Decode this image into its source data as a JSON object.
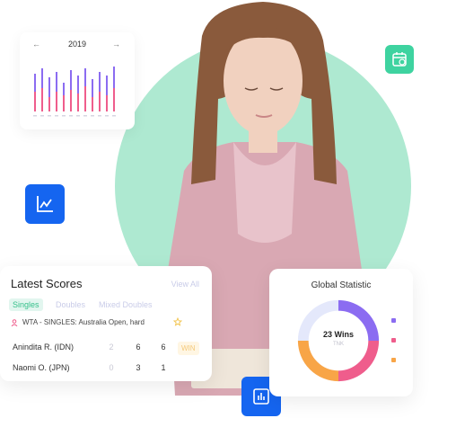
{
  "year_card": {
    "prev_icon": "arrow-left-icon",
    "next_icon": "arrow-right-icon",
    "year": "2019",
    "prev_label": "←",
    "next_label": "→"
  },
  "icons": {
    "calendar_badge": "calendar-icon",
    "line_chart_badge": "line-chart-icon",
    "bar_chart_badge": "bar-chart-icon"
  },
  "latest_scores": {
    "title": "Latest Scores",
    "view_all": "View All",
    "tabs": [
      "Singles",
      "Doubles",
      "Mixed Doubles"
    ],
    "event": "WTA - SINGLES: Australia Open, hard",
    "players": [
      {
        "name": "Anindita R. (IDN)",
        "scores": [
          "2",
          "6",
          "6"
        ]
      },
      {
        "name": "Naomi O. (JPN)",
        "scores": [
          "0",
          "3",
          "1"
        ]
      }
    ],
    "result": "WIN"
  },
  "global_statistic": {
    "title": "Global Statistic",
    "center_value": "23 Wins",
    "center_sub": "TNK"
  },
  "colors": {
    "accent_green": "#3ed3a0",
    "accent_blue": "#1565f0",
    "purple": "#8b6cf1",
    "pink": "#ef5d8c",
    "orange": "#f8a547"
  }
}
